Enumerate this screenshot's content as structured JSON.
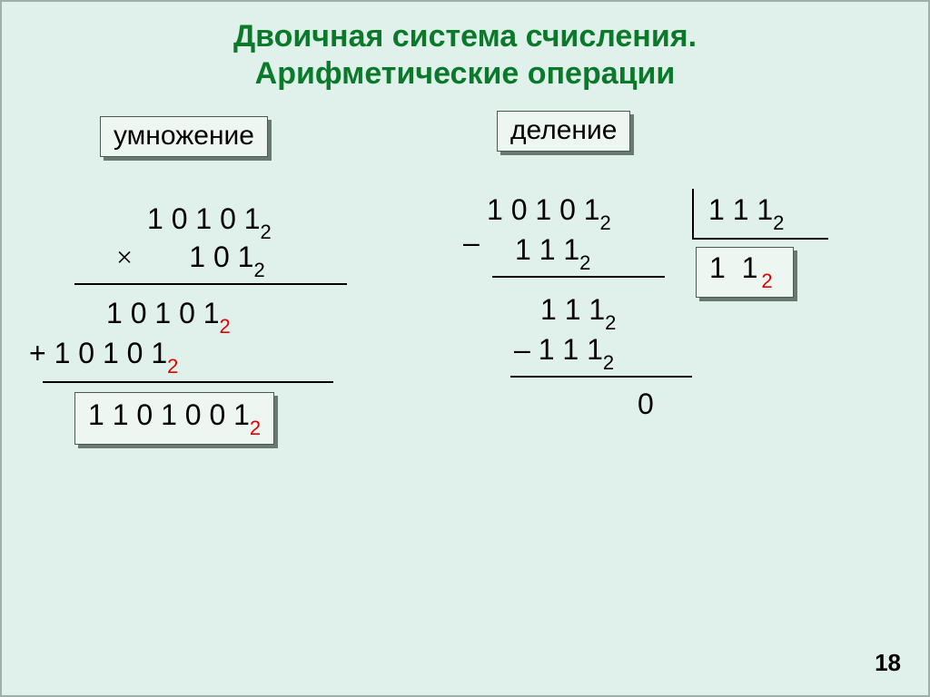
{
  "title": {
    "line1": "Двоичная система счисления.",
    "line2": "Арифметические операции"
  },
  "multiplication": {
    "label": "умножение",
    "operand1": "1 0 1 0 1",
    "sub1": "2",
    "op": "×",
    "operand2": "1 0 1",
    "sub2": "2",
    "partial1": "1 0 1 0 1",
    "partial1_sub": "2",
    "partial2": "+ 1 0 1 0 1",
    "partial2_sub": "2",
    "result": "1 1 0 1 0 0 1",
    "result_sub": "2"
  },
  "division": {
    "label": "деление",
    "dividend": "1 0 1 0 1",
    "dividend_sub": "2",
    "minus1": "–",
    "sub1": "1 1 1",
    "sub1_sub": "2",
    "rem1": "1 1 1",
    "rem1_sub": "2",
    "minus2": "– 1 1 1",
    "sub2_sub": "2",
    "rem2": "0",
    "divisor": "1 1 1",
    "divisor_sub": "2",
    "quotient": "1  1",
    "quotient_sub": "2"
  },
  "page_number": "18"
}
